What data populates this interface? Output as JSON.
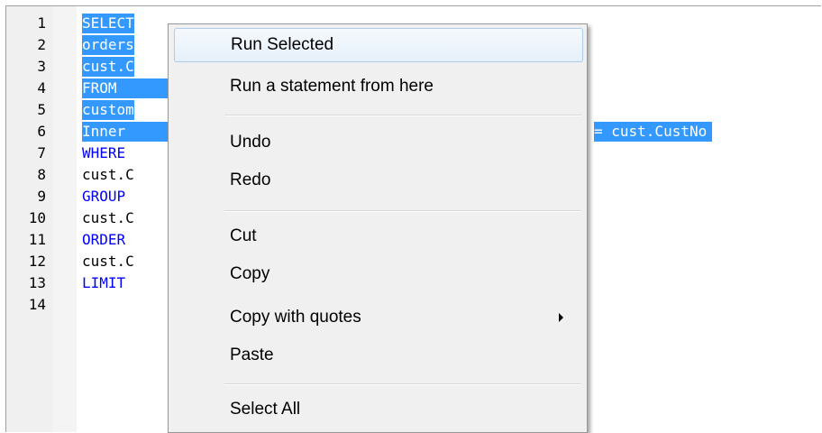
{
  "editor": {
    "line_numbers": [
      "1",
      "2",
      "3",
      "4",
      "5",
      "6",
      "7",
      "8",
      "9",
      "10",
      "11",
      "12",
      "13",
      "14"
    ],
    "lines": [
      {
        "text": "SELECT",
        "style": "sel"
      },
      {
        "text": "orders",
        "style": "sel"
      },
      {
        "text": "cust.C",
        "style": "sel"
      },
      {
        "text": "FROM",
        "style": "sel"
      },
      {
        "text": "custom",
        "style": "sel"
      },
      {
        "text": "Inner",
        "style": "sel"
      },
      {
        "text": "WHERE",
        "style": "kw"
      },
      {
        "text": "cust.C",
        "style": "plain"
      },
      {
        "text": "GROUP",
        "style": "kw"
      },
      {
        "text": "cust.C",
        "style": "plain"
      },
      {
        "text": "ORDER",
        "style": "kw"
      },
      {
        "text": "cust.C",
        "style": "plain"
      },
      {
        "text": "LIMIT",
        "style": "kw"
      },
      {
        "text": "",
        "style": "plain"
      }
    ],
    "line6_tail": "= cust.CustNo"
  },
  "context_menu": {
    "items": [
      {
        "label": "Run Selected"
      },
      {
        "label": "Run a statement from here"
      },
      {
        "label": "Undo"
      },
      {
        "label": "Redo"
      },
      {
        "label": "Cut"
      },
      {
        "label": "Copy"
      },
      {
        "label": "Copy with quotes"
      },
      {
        "label": "Paste"
      },
      {
        "label": "Select All"
      }
    ]
  }
}
